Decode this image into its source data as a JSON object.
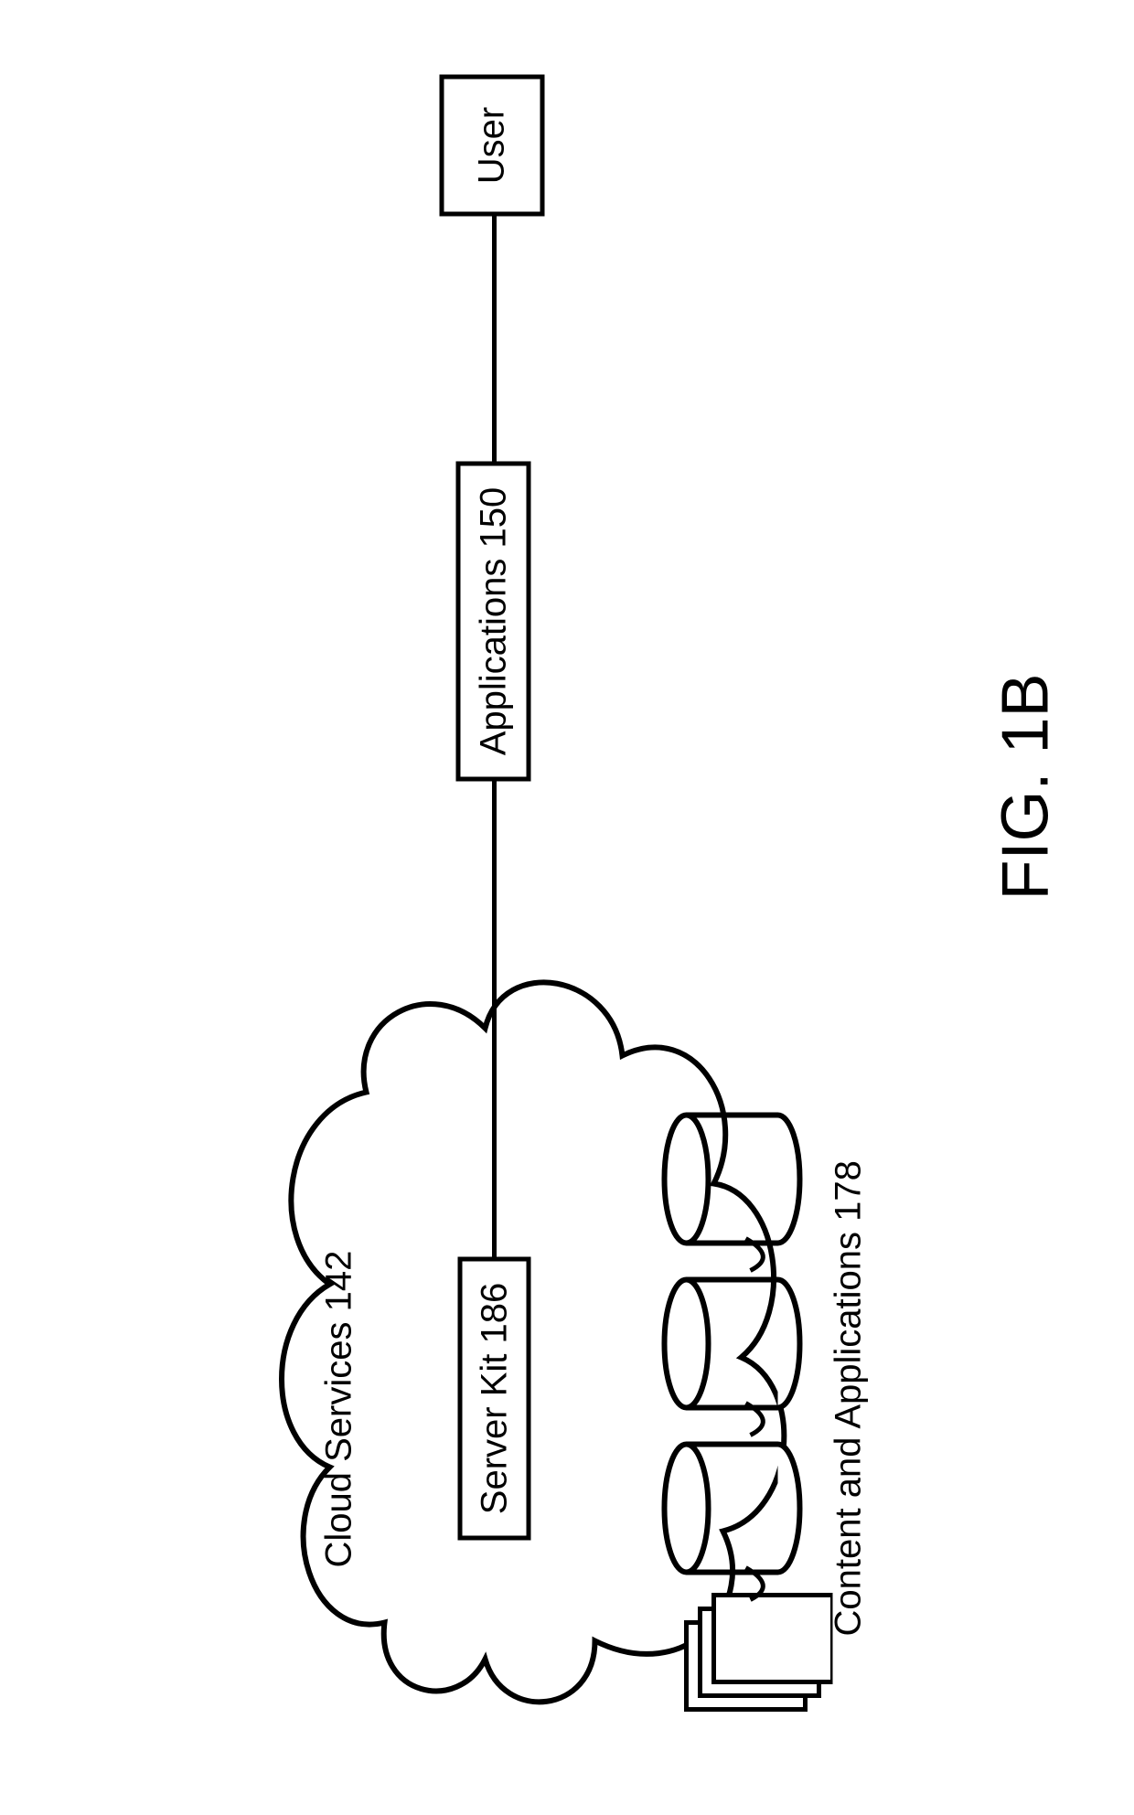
{
  "figure": "FIG. 1B",
  "cloud": {
    "title": "Cloud Services 142",
    "server": "Server Kit 186",
    "content": "Content and Applications 178"
  },
  "apps": "Applications 150",
  "user": "User"
}
